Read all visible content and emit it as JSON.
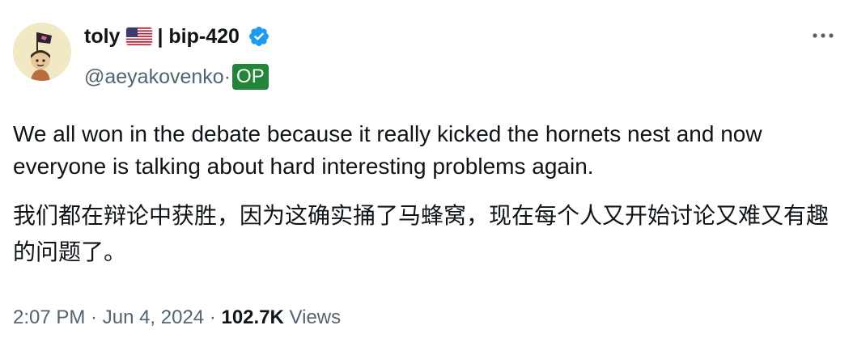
{
  "tweet": {
    "author": {
      "name": "toly",
      "flag": "🇺🇸",
      "separator": "| bip-420",
      "handle": "@aeyakovenko·",
      "badge": "OP",
      "verified": true,
      "avatar_icon": "avatar-icon"
    },
    "text_en": "We all won in the debate because it really kicked the hornets nest and now everyone is talking about hard interesting problems again.",
    "text_zh": "我们都在辩论中获胜，因为这确实捅了马蜂窝，现在每个人又开始讨论又难又有趣的问题了。",
    "meta": {
      "time": "2:07 PM",
      "dot1": " · ",
      "date": "Jun 4, 2024",
      "dot2": " · ",
      "views_count": "102.7K",
      "views_label": " Views"
    }
  },
  "icons": {
    "more": "more-options-icon",
    "verified": "verified-badge-icon",
    "flag": "us-flag-icon"
  },
  "colors": {
    "text_primary": "#0f1419",
    "text_secondary": "#536471",
    "verified_blue": "#1d9bf0",
    "op_badge": "#22863a"
  }
}
